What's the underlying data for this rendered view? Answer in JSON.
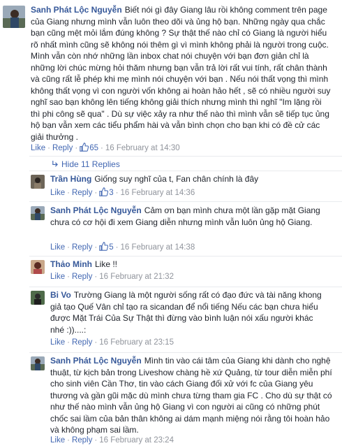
{
  "top_comment": {
    "author": "Sanh Phát Lộc Nguyễn",
    "text": "Biết nói gì đây Giang lâu rồi không comment trên page của Giang nhưng mình vẫn luôn theo dõi và ủng hộ bạn. Những ngày qua chắc bạn cũng mệt mỏi lắm đúng không ? Sự thật thế nào chỉ có Giang là người hiểu rõ nhất mình cũng sẽ không nói thêm gì vì mình không phải là người trong cuộc. Mình vẫn còn nhớ những lần inbox chat nói chuyện với bạn đơn giản chỉ là những lời chúc mừng hỏi thăm nhưng bạn vẫn trả lời rất vui tính, rất chân thành và cũng rất lễ phép khi mẹ mình nói chuyện với bạn . Nếu nói thất vọng thì mình không thất vọng vì con người vốn không ai hoàn hảo hết , sẽ có nhiều người suy nghĩ sao bạn không lên tiếng không giải thích nhưng mình thì nghĩ \"Im lặng rồi thì phi công sẽ qua\" . Dù sự việc xảy ra như thế nào thì mình vẫn sẽ tiếp tục ủng hộ bạn vẫn xem các tiểu phẩm hài và vẫn bình chọn cho bạn khi có đề cử các giải thưởng .",
    "like": "Like",
    "reply": "Reply",
    "likes": "65",
    "time": "16 February at 14:30"
  },
  "hide_replies": "Hide 11 Replies",
  "replies": [
    {
      "author": "Trần Hùng",
      "text": "Giống suy nghĩ của t, Fan chân chính là đây",
      "like": "Like",
      "reply": "Reply",
      "likes": "3",
      "time": "16 February at 14:36"
    },
    {
      "author": "Sanh Phát Lộc Nguyễn",
      "text": "Cảm ơn bạn mình chưa một lần gặp mặt Giang chưa có cơ hội đi xem Giang diễn nhưng mình vẫn luôn ủng hộ Giang.",
      "like": "Like",
      "reply": "Reply",
      "likes": "5",
      "time": "16 February at 14:38"
    },
    {
      "author": "Thảo Minh",
      "text": "Like !!",
      "like": "Like",
      "reply": "Reply",
      "likes": "",
      "time": "16 February at 21:32"
    },
    {
      "author": "Bi Vo",
      "text": "Trường Giang là một người sống rất có đạo đức và tài năng khong giả tạo Quế Vân chỉ tạo ra sicandan để nổi tiếng Nếu các bạn chưa hiểu được Mặt Trái Của Sự Thật thì đừng vào bình luận nói xấu người khác nhé :))....:",
      "like": "Like",
      "reply": "Reply",
      "likes": "",
      "time": "16 February at 23:15"
    },
    {
      "author": "Sanh Phát Lộc Nguyễn",
      "text": "Mình tin vào cái tâm của Giang khi dành cho nghệ thuật, từ kịch bản trong Liveshow chàng hề xứ Quảng, từ tour diễn miễn phí cho sinh viên Cần Thơ, tin vào cách Giang đối xử với fc của Giang yêu thương và gần gũi mặc dù mình chưa từng tham gia FC . Cho dù sự thật có như thế nào mình vẫn ủng hộ Giang vì con người ai cũng có những phút chốc sai lầm của bản thân không ai dám mạnh miệng nói rằng tôi hoàn hảo và không phạm sai lầm.",
      "like": "Like",
      "reply": "Reply",
      "likes": "",
      "time": "16 February at 23:24"
    }
  ],
  "colors": {
    "link": "#4267b2",
    "author": "#365899",
    "meta": "#90949c",
    "text": "#1d2129"
  }
}
